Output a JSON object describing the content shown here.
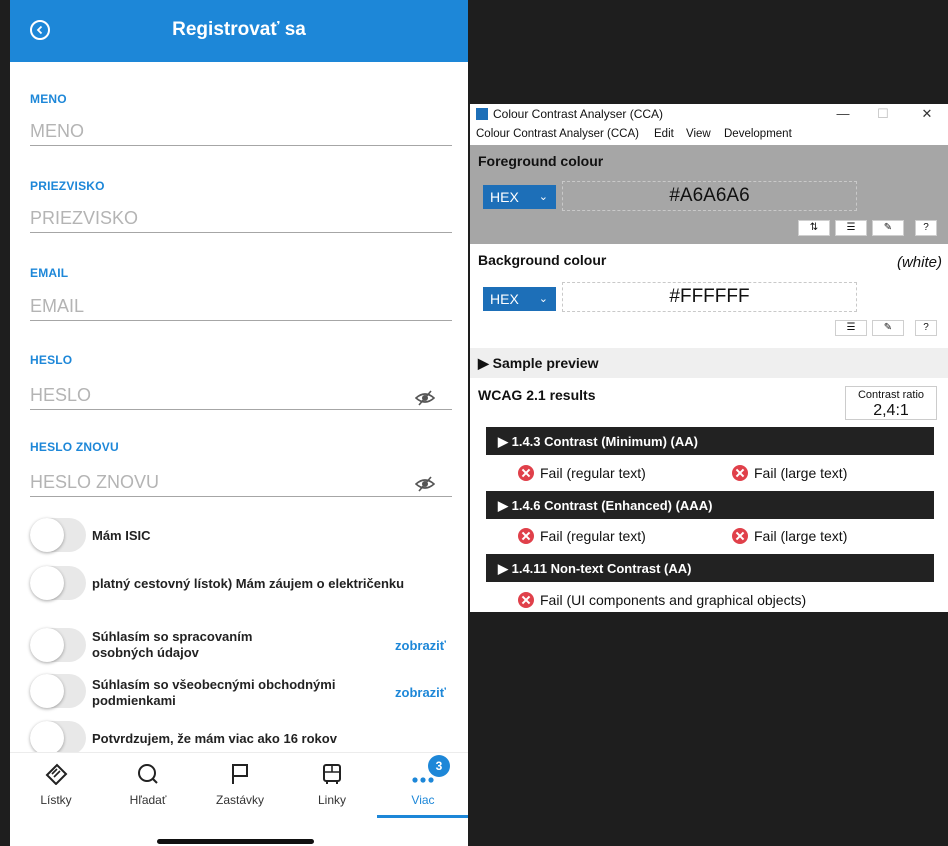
{
  "app": {
    "title": "Registrovať sa",
    "fields": [
      {
        "label": "MENO",
        "placeholder": "MENO"
      },
      {
        "label": "PRIEZVISKO",
        "placeholder": "PRIEZVISKO"
      },
      {
        "label": "EMAIL",
        "placeholder": "EMAIL"
      },
      {
        "label": "HESLO",
        "placeholder": "HESLO"
      },
      {
        "label": "HESLO ZNOVU",
        "placeholder": "HESLO ZNOVU"
      }
    ],
    "toggles": [
      {
        "label": "Mám ISIC"
      },
      {
        "label": "platný cestovný lístok)  Mám záujem o električenku"
      },
      {
        "label": "Súhlasím so spracovaním osobných údajov",
        "link": "zobraziť"
      },
      {
        "label": "Súhlasím so všeobecnými obchodnými podmienkami",
        "link": "zobraziť"
      },
      {
        "label": "Potvrdzujem, že mám viac ako 16 rokov"
      }
    ],
    "tabs": [
      {
        "label": "Lístky",
        "icon": "ticket-icon"
      },
      {
        "label": "Hľadať",
        "icon": "search-icon"
      },
      {
        "label": "Zastávky",
        "icon": "flag-icon"
      },
      {
        "label": "Linky",
        "icon": "bus-icon"
      },
      {
        "label": "Viac",
        "icon": "more-icon"
      }
    ],
    "active_tab": "Viac",
    "badge_count": "3",
    "accent_color": "#1d87d8"
  },
  "cca": {
    "window_title": "Colour Contrast Analyser (CCA)",
    "menu": [
      "Colour Contrast Analyser (CCA)",
      "Edit",
      "View",
      "Development"
    ],
    "window_buttons": {
      "minimize": "—",
      "maximize": "☐",
      "close": "✕"
    },
    "foreground": {
      "title": "Foreground colour",
      "format": "HEX",
      "value": "#A6A6A6"
    },
    "background": {
      "title": "Background colour",
      "format": "HEX",
      "value": "#FFFFFF",
      "name": "(white)"
    },
    "sample_preview": "▶  Sample preview",
    "wcag_title": "WCAG 2.1 results",
    "contrast_ratio_label": "Contrast ratio",
    "contrast_ratio": "2,4:1",
    "criteria": [
      {
        "title": "▶  1.4.3 Contrast (Minimum) (AA)",
        "results": [
          "Fail (regular text)",
          "Fail (large text)"
        ]
      },
      {
        "title": "▶  1.4.6 Contrast (Enhanced) (AAA)",
        "results": [
          "Fail (regular text)",
          "Fail (large text)"
        ]
      },
      {
        "title": "▶  1.4.11 Non-text Contrast (AA)",
        "results": [
          "Fail (UI components and graphical objects)"
        ]
      }
    ],
    "fail_color": "#e0404a"
  }
}
